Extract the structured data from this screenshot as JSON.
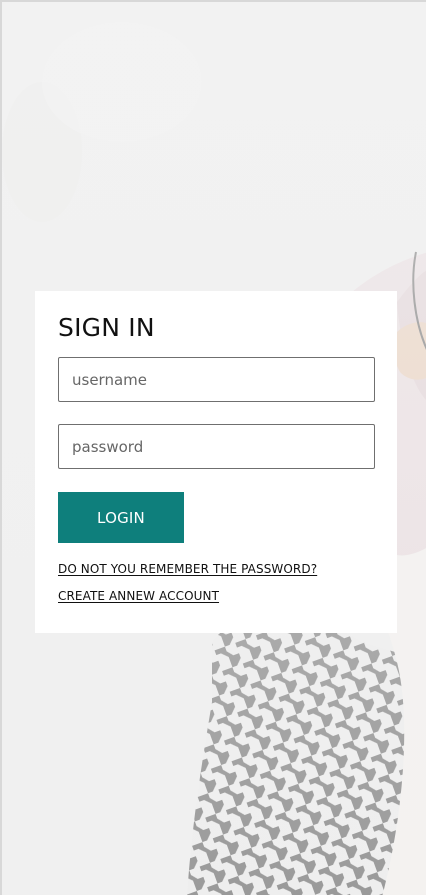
{
  "login": {
    "title": "SIGN IN",
    "username_placeholder": "username",
    "password_placeholder": "password",
    "login_button_label": "LOGIN",
    "forgot_password_link": "DO NOT YOU REMEMBER THE PASSWORD?",
    "create_account_link": "CREATE ANNEW ACCOUNT"
  },
  "colors": {
    "accent": "#0e7f7c",
    "background": "#efefef",
    "card": "#ffffff"
  }
}
